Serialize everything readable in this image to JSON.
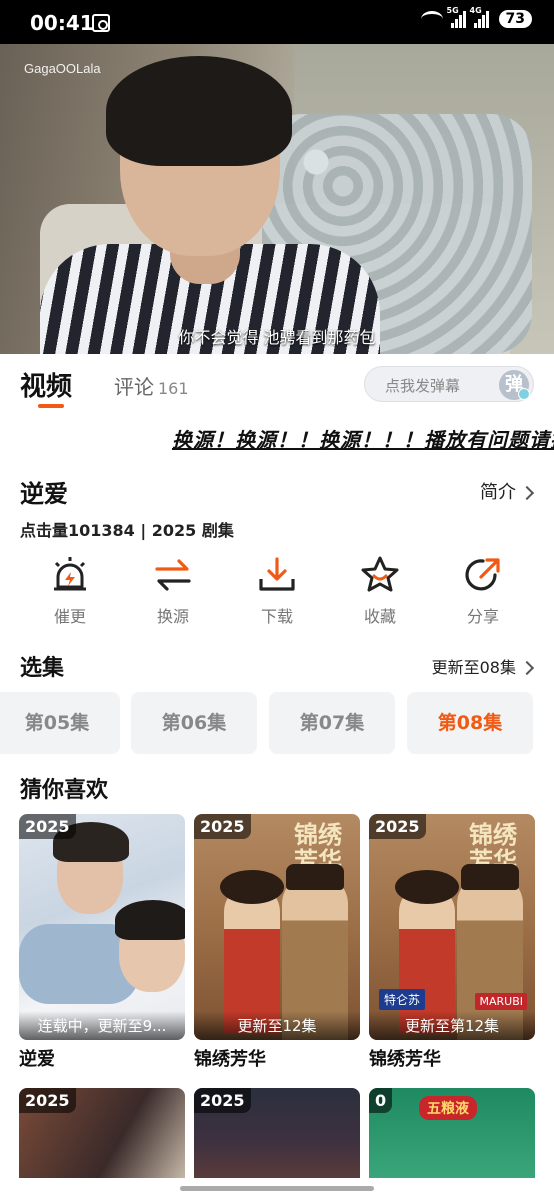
{
  "status_bar": {
    "time": "00:41",
    "network_a": "5G",
    "network_b": "4G",
    "battery": "73"
  },
  "player": {
    "watermark": "GagaOOLala",
    "subtitle": "你不会觉得 池骋看到那药包"
  },
  "tabs": {
    "video": "视频",
    "comments": "评论",
    "comments_count": "161",
    "danmaku_placeholder": "点我发弹幕",
    "danmaku_icon_text": "弹"
  },
  "marquee": "换源！换源！！换源！！！播放有问题请换源",
  "show": {
    "title": "逆爱",
    "intro_link": "简介",
    "meta": "点击量101384 | 2025 剧集"
  },
  "actions": [
    {
      "label": "催更",
      "icon": "alarm-icon"
    },
    {
      "label": "换源",
      "icon": "swap-icon"
    },
    {
      "label": "下载",
      "icon": "download-icon"
    },
    {
      "label": "收藏",
      "icon": "star-icon"
    },
    {
      "label": "分享",
      "icon": "share-icon"
    }
  ],
  "episodes": {
    "title": "选集",
    "more": "更新至08集",
    "items": [
      "第05集",
      "第06集",
      "第07集",
      "第08集"
    ],
    "active_index": 3
  },
  "recommend": {
    "title": "猜你喜欢",
    "items": [
      {
        "year": "2025",
        "status": "连载中，更新至9...",
        "title": "逆爱"
      },
      {
        "year": "2025",
        "status": "更新至12集",
        "title": "锦绣芳华",
        "poster_title": "锦绣芳华"
      },
      {
        "year": "2025",
        "status": "更新至第12集",
        "title": "锦绣芳华",
        "poster_title": "锦绣芳华",
        "logo_left": "特仑苏",
        "logo_right": "MARUBI"
      }
    ],
    "second_row": [
      {
        "year": "2025"
      },
      {
        "year": "2025"
      },
      {
        "year": "0",
        "tag": "五粮液"
      }
    ]
  },
  "colors": {
    "accent": "#f05a14",
    "text": "#111111",
    "muted": "#888888"
  }
}
